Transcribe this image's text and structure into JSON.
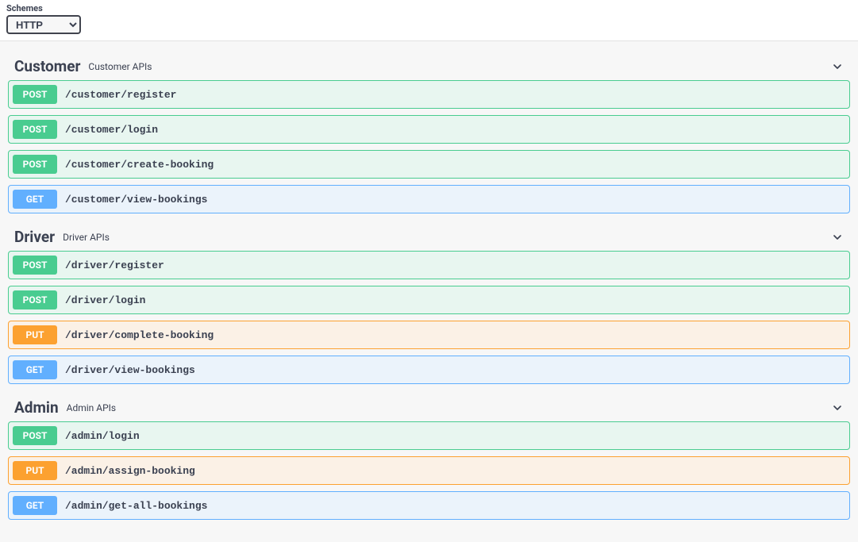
{
  "schemes": {
    "label": "Schemes",
    "selected": "HTTP"
  },
  "tags": [
    {
      "name": "Customer",
      "desc": "Customer APIs",
      "ops": [
        {
          "method": "POST",
          "methodClass": "post",
          "path": "/customer/register"
        },
        {
          "method": "POST",
          "methodClass": "post",
          "path": "/customer/login"
        },
        {
          "method": "POST",
          "methodClass": "post",
          "path": "/customer/create-booking"
        },
        {
          "method": "GET",
          "methodClass": "get",
          "path": "/customer/view-bookings"
        }
      ]
    },
    {
      "name": "Driver",
      "desc": "Driver APIs",
      "ops": [
        {
          "method": "POST",
          "methodClass": "post",
          "path": "/driver/register"
        },
        {
          "method": "POST",
          "methodClass": "post",
          "path": "/driver/login"
        },
        {
          "method": "PUT",
          "methodClass": "put",
          "path": "/driver/complete-booking"
        },
        {
          "method": "GET",
          "methodClass": "get",
          "path": "/driver/view-bookings"
        }
      ]
    },
    {
      "name": "Admin",
      "desc": "Admin APIs",
      "ops": [
        {
          "method": "POST",
          "methodClass": "post",
          "path": "/admin/login"
        },
        {
          "method": "PUT",
          "methodClass": "put",
          "path": "/admin/assign-booking"
        },
        {
          "method": "GET",
          "methodClass": "get",
          "path": "/admin/get-all-bookings"
        }
      ]
    }
  ]
}
